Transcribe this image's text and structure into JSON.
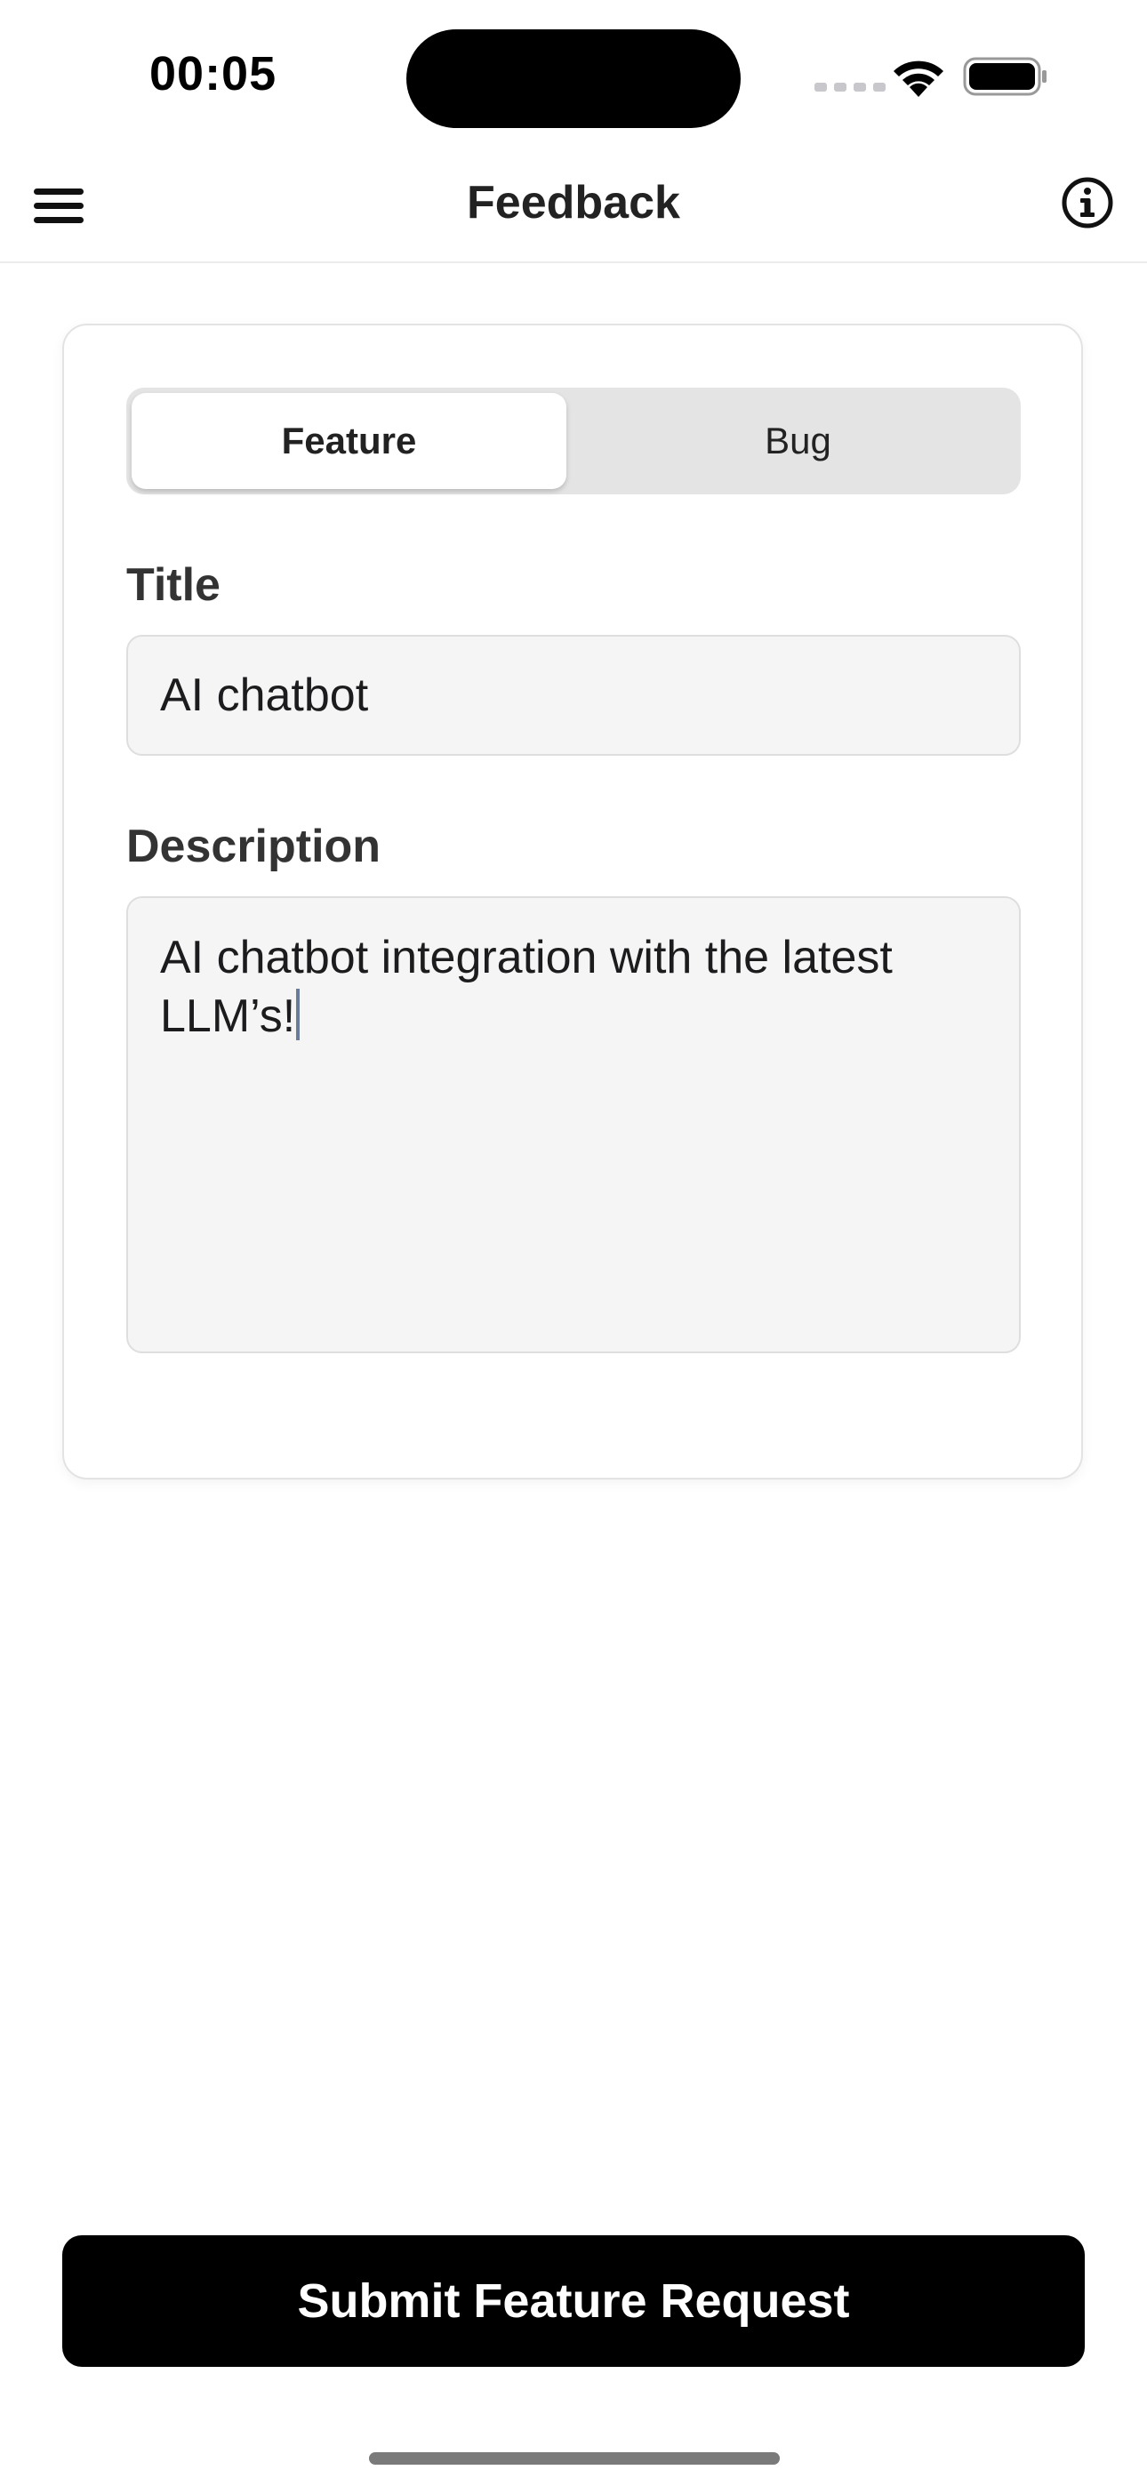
{
  "status_bar": {
    "time": "00:05"
  },
  "nav": {
    "title": "Feedback",
    "left_icon": "menu-icon",
    "right_icon": "info-icon"
  },
  "form": {
    "segments": [
      {
        "label": "Feature",
        "selected": true
      },
      {
        "label": "Bug",
        "selected": false
      }
    ],
    "title_label": "Title",
    "title_value": "AI chatbot",
    "description_label": "Description",
    "description_value": "AI chatbot integration with the latest LLM’s!"
  },
  "submit": {
    "label": "Submit Feature Request"
  },
  "colors": {
    "primary_button": "#000000",
    "field_background": "#f5f5f5",
    "segment_track": "#e4e4e4"
  }
}
